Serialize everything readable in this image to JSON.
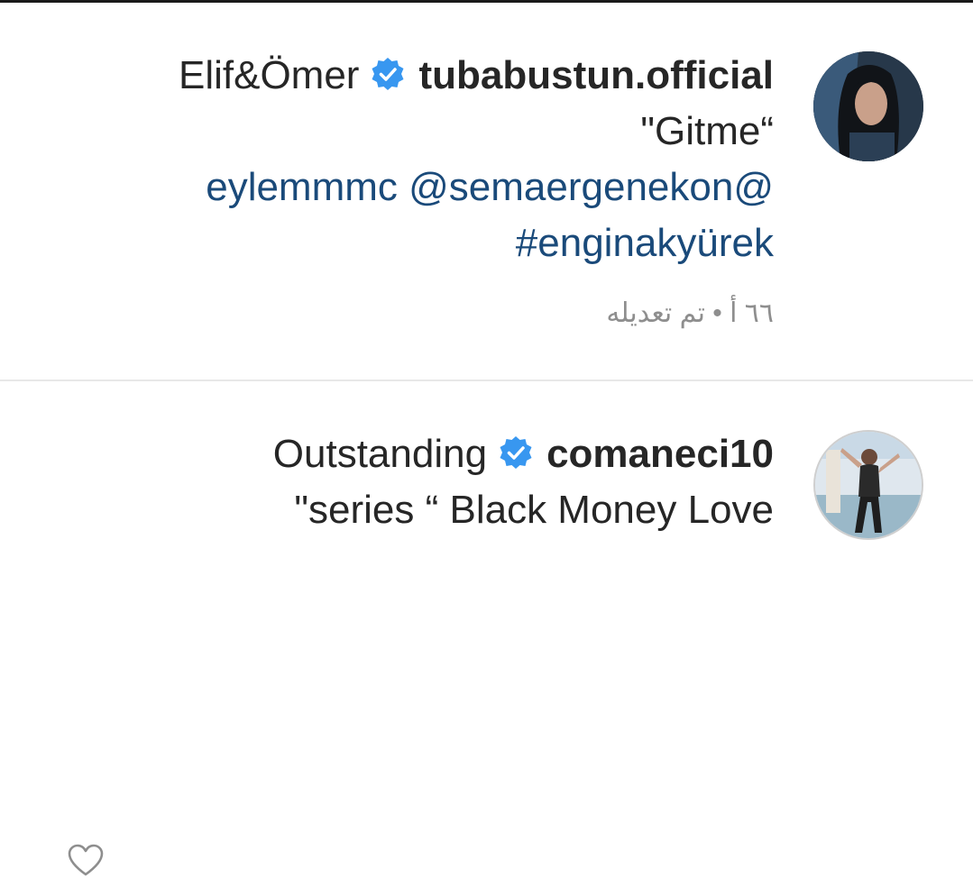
{
  "comments": [
    {
      "avatar": "woman-dark-hair-photo",
      "text_before_badge": "Elif&Ömer",
      "username": "tubabustun.official",
      "verified": true,
      "lines": [
        {
          "text": "\"Gitme“",
          "type": "text"
        },
        {
          "text": "eylemmmc @semaergenekon@",
          "type": "link"
        },
        {
          "text": "#enginakyürek",
          "type": "link"
        }
      ],
      "meta": "٦٦ أ • تم تعديله"
    },
    {
      "avatar": "woman-gym-photo",
      "text_before_badge": "Outstanding",
      "username": "comaneci10",
      "verified": true,
      "lines": [
        {
          "text": "\"series “ Black Money Love",
          "type": "text"
        }
      ],
      "like_icon": "heart-outline-icon"
    }
  ],
  "colors": {
    "link": "#1a4a7a",
    "verified_badge": "#3897f0",
    "meta_text": "#8e8e8e"
  }
}
